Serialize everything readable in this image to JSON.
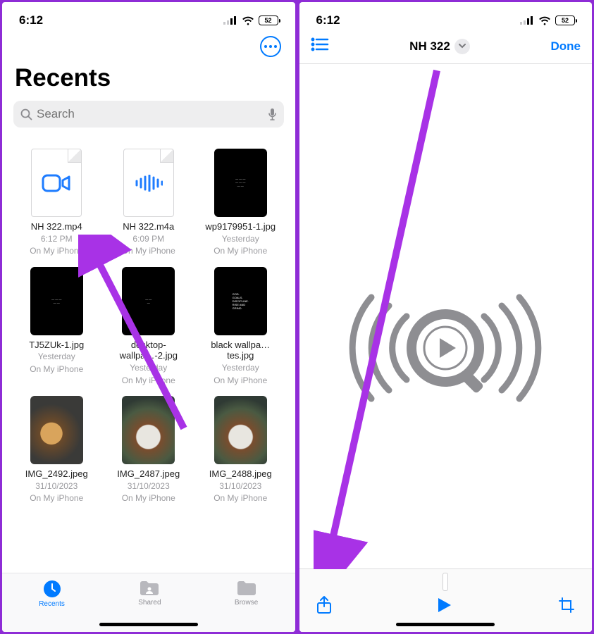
{
  "status": {
    "time": "6:12",
    "battery": "52"
  },
  "left": {
    "title": "Recents",
    "search_placeholder": "Search",
    "files": [
      {
        "name": "NH 322.mp4",
        "time": "6:12 PM",
        "loc": "On My iPhone",
        "kind": "video"
      },
      {
        "name": "NH 322.m4a",
        "time": "6:09 PM",
        "loc": "On My iPhone",
        "kind": "audio"
      },
      {
        "name": "wp9179951-1.jpg",
        "time": "Yesterday",
        "loc": "On My iPhone",
        "kind": "black1"
      },
      {
        "name": "TJ5ZUk-1.jpg",
        "time": "Yesterday",
        "loc": "On My iPhone",
        "kind": "black2"
      },
      {
        "name": "desktop-wallpa…-2.jpg",
        "time": "Yesterday",
        "loc": "On My iPhone",
        "kind": "black3"
      },
      {
        "name": "black wallpa…tes.jpg",
        "time": "Yesterday",
        "loc": "On My iPhone",
        "kind": "black4"
      },
      {
        "name": "IMG_2492.jpeg",
        "time": "31/10/2023",
        "loc": "On My iPhone",
        "kind": "photo1"
      },
      {
        "name": "IMG_2487.jpeg",
        "time": "31/10/2023",
        "loc": "On My iPhone",
        "kind": "photo2"
      },
      {
        "name": "IMG_2488.jpeg",
        "time": "31/10/2023",
        "loc": "On My iPhone",
        "kind": "photo3"
      }
    ],
    "tabs": {
      "recents": "Recents",
      "shared": "Shared",
      "browse": "Browse"
    }
  },
  "right": {
    "title": "NH 322",
    "done": "Done"
  }
}
